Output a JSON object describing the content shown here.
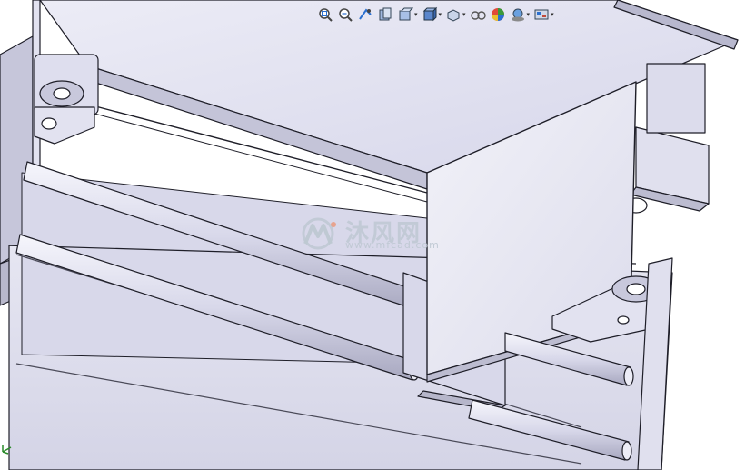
{
  "toolbar": {
    "items": [
      {
        "name": "zoom-to-fit-icon",
        "caret": false
      },
      {
        "name": "zoom-to-area-icon",
        "caret": false
      },
      {
        "name": "previous-view-icon",
        "caret": false
      },
      {
        "name": "section-view-icon",
        "caret": false
      },
      {
        "name": "dynamic-annotation-views-icon",
        "caret": true
      },
      {
        "name": "view-orientation-icon",
        "caret": true
      },
      {
        "name": "display-style-icon",
        "caret": true
      },
      {
        "name": "hide-show-items-icon",
        "caret": false
      },
      {
        "name": "edit-appearance-icon",
        "caret": false
      },
      {
        "name": "apply-scene-icon",
        "caret": true
      },
      {
        "name": "view-settings-icon",
        "caret": true
      }
    ],
    "caret_glyph": "▾"
  },
  "watermark": {
    "text_cn": "沐风网",
    "text_url": "www.mfcad.com"
  },
  "colors": {
    "part_face_light": "#e4e4f2",
    "part_face_mid": "#d2d2e6",
    "part_face_dark": "#b4b4c8",
    "edge": "#1e1e28",
    "background": "#ffffff",
    "watermark": "#c0c8d2"
  }
}
